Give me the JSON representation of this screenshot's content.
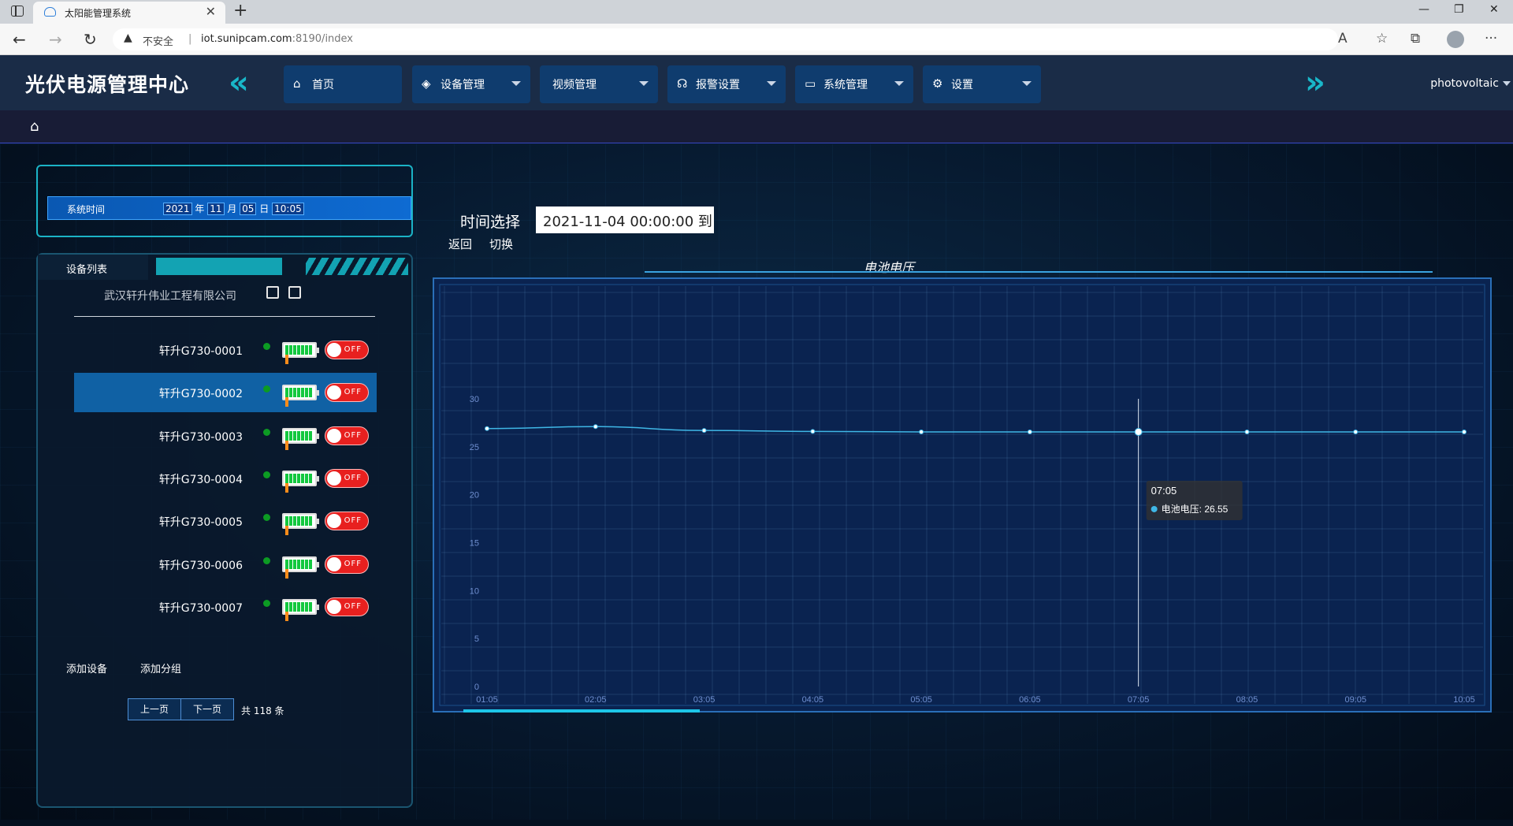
{
  "browser": {
    "tab_title": "太阳能管理系统",
    "tab_close": "✕",
    "new_tab": "+",
    "insecure_label": "不安全",
    "url_separator": "|",
    "url_host": "iot.sunipcam.com",
    "url_path": ":8190/index",
    "win_minimize": "—",
    "win_restore": "❐",
    "win_close": "✕",
    "more": "···"
  },
  "header": {
    "brand": "光伏电源管理中心",
    "collapse_chevron": "«",
    "expand_chevron": "»",
    "nav": [
      {
        "label": "首页",
        "icon": "⌂",
        "dropdown": false
      },
      {
        "label": "设备管理",
        "icon": "◈",
        "dropdown": true
      },
      {
        "label": "视频管理",
        "icon": "",
        "dropdown": true
      },
      {
        "label": "报警设置",
        "icon": "☊",
        "dropdown": true
      },
      {
        "label": "系统管理",
        "icon": "▭",
        "dropdown": true
      },
      {
        "label": "设置",
        "icon": "⚙",
        "dropdown": true
      }
    ],
    "user": "photovoltaic"
  },
  "breadcrumb": {
    "home_icon": "⌂"
  },
  "system_time": {
    "label": "系统时间",
    "year": "2021",
    "year_unit": "年",
    "month": "11",
    "month_unit": "月",
    "day": "05",
    "day_unit": "日",
    "time": "10:05"
  },
  "device_list": {
    "title": "设备列表",
    "company": "武汉轩升伟业工程有限公司",
    "devices": [
      {
        "name": "轩升G730-0001",
        "online": true,
        "switch": "OFF",
        "selected": false
      },
      {
        "name": "轩升G730-0002",
        "online": true,
        "switch": "OFF",
        "selected": true
      },
      {
        "name": "轩升G730-0003",
        "online": true,
        "switch": "OFF",
        "selected": false
      },
      {
        "name": "轩升G730-0004",
        "online": true,
        "switch": "OFF",
        "selected": false
      },
      {
        "name": "轩升G730-0005",
        "online": true,
        "switch": "OFF",
        "selected": false
      },
      {
        "name": "轩升G730-0006",
        "online": true,
        "switch": "OFF",
        "selected": false
      },
      {
        "name": "轩升G730-0007",
        "online": true,
        "switch": "OFF",
        "selected": false
      }
    ],
    "add_device": "添加设备",
    "add_group": "添加分组",
    "prev_page": "上一页",
    "next_page": "下一页",
    "total": "共 118 条"
  },
  "filter": {
    "label": "时间选择",
    "value": "2021-11-04 00:00:00 到",
    "back": "返回",
    "switch": "切换"
  },
  "colors": {
    "accent": "#19b7c9",
    "nav_bg": "#0f3c6e",
    "line": "#3fb7e6",
    "toggle_off": "#e8201f",
    "online": "#0c9b23"
  },
  "chart_data": {
    "type": "line",
    "title": "电池电压",
    "xlabel": "",
    "ylabel": "",
    "x": [
      "01:05",
      "02:05",
      "03:05",
      "04:05",
      "05:05",
      "06:05",
      "07:05",
      "08:05",
      "09:05",
      "10:05"
    ],
    "series": [
      {
        "name": "电池电压",
        "values": [
          26.9,
          27.1,
          26.7,
          26.6,
          26.55,
          26.55,
          26.55,
          26.55,
          26.55,
          26.55
        ]
      }
    ],
    "ylim": [
      0,
      30
    ],
    "yticks": [
      0,
      5,
      10,
      15,
      20,
      25,
      30
    ],
    "grid": true,
    "tooltip": {
      "title": "07:05",
      "series": "电池电压",
      "value": "26.55",
      "index": 6
    }
  }
}
